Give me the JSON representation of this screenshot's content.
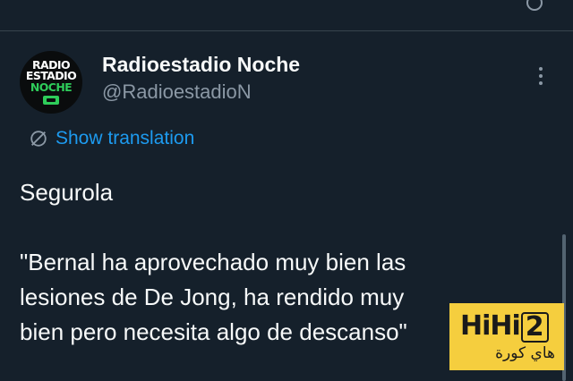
{
  "tweet": {
    "author": {
      "display_name": "Radioestadio Noche",
      "handle": "@RadioestadioN",
      "avatar_logo": [
        "RADIO",
        "ESTADIO",
        "NOCHE"
      ]
    },
    "more_icon": "more-vertical-icon",
    "translation": {
      "icon": "translate-globe-icon",
      "label": "Show translation",
      "link_color": "#1d9bf0"
    },
    "text_lines": [
      "Segurola",
      "",
      "\"Bernal ha aprovechado muy bien las",
      "lesiones de De Jong, ha rendido muy",
      "bien pero necesita algo de descanso\""
    ]
  },
  "watermark": {
    "brand_main": "HiHi",
    "brand_boxed": "2",
    "arabic_text": "هاي كورة",
    "color": "#f5ce3e"
  },
  "theme": {
    "background": "#15202b",
    "text": "#f7f9f9",
    "secondary_text": "#8b98a5"
  }
}
